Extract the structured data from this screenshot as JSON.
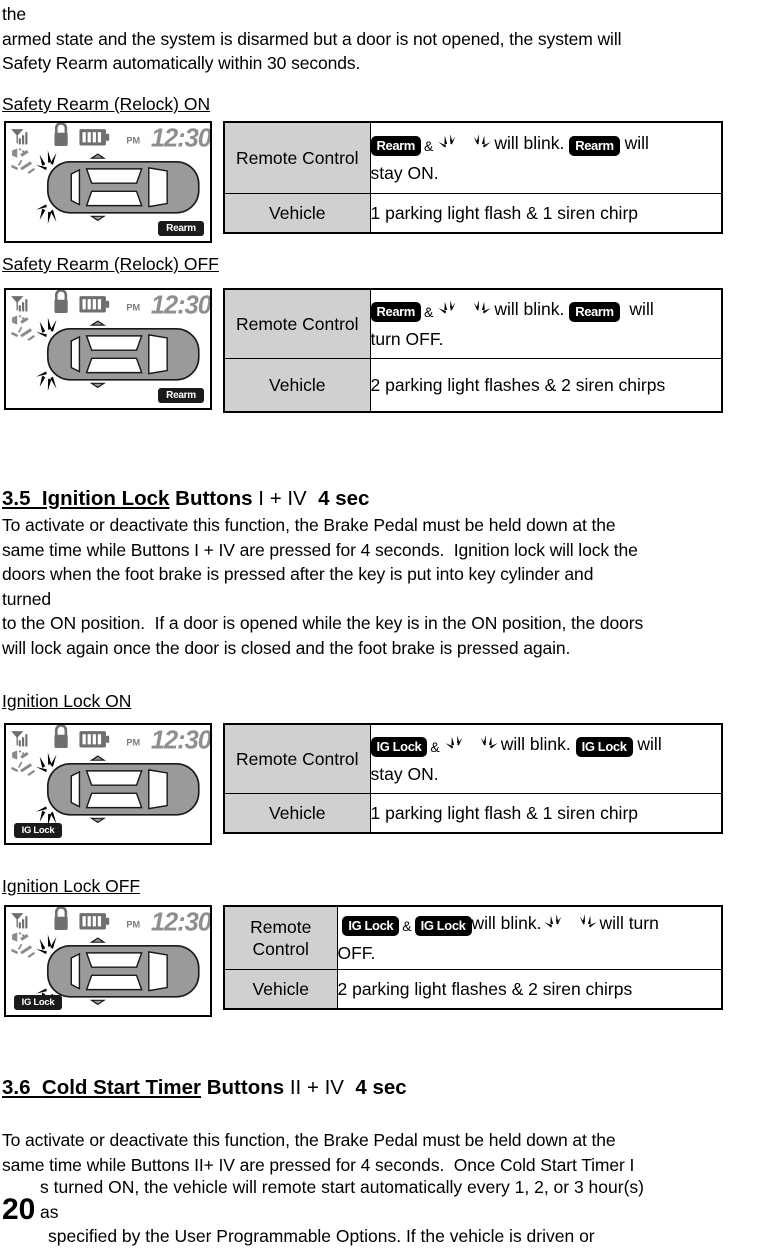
{
  "document": {
    "page_number": "20",
    "intro": {
      "line1": "the",
      "line2": "armed state and the system is disarmed but a door is not opened, the system will",
      "line3": "Safety Rearm automatically within 30 seconds."
    },
    "sections": [
      {
        "id": "safety-rearm-on",
        "heading": "Safety Rearm (Relock) ON",
        "lcd": {
          "time": "12:30",
          "meridiem": "PM",
          "badge": "Rearm",
          "icons": [
            "antenna-signal-icon",
            "lock-icon",
            "battery-icon",
            "siren-icon",
            "horn-icon",
            "car-top-view",
            "flash-burst-left-top",
            "flash-burst-left-bottom"
          ]
        },
        "rows": [
          {
            "label": "Remote Control",
            "value_parts": [
              {
                "type": "badge",
                "text": "Rearm"
              },
              {
                "type": "text",
                "text": "&"
              },
              {
                "type": "blink-icon"
              },
              {
                "type": "text",
                "text": "will blink."
              },
              {
                "type": "badge",
                "text": "Rearm"
              },
              {
                "type": "text",
                "text": "will stay ON."
              }
            ],
            "value_plain": "Rearm & (blink icons) will blink. Rearm will stay ON."
          },
          {
            "label": "Vehicle",
            "value_plain": "1 parking light flash & 1 siren chirp"
          }
        ]
      },
      {
        "id": "safety-rearm-off",
        "heading": "Safety Rearm (Relock) OFF",
        "lcd": {
          "time": "12:30",
          "meridiem": "PM",
          "badge": "Rearm",
          "icons": [
            "antenna-signal-icon",
            "lock-icon",
            "battery-icon",
            "siren-icon",
            "horn-icon",
            "car-top-view",
            "flash-burst-left-top",
            "flash-burst-left-bottom"
          ]
        },
        "rows": [
          {
            "label": "Remote Control",
            "value_plain": "Rearm & (blink icons) will blink. Rearm will turn OFF."
          },
          {
            "label": "Vehicle",
            "value_plain": "2 parking light flashes & 2 siren chirps"
          }
        ]
      }
    ],
    "section35": {
      "number": "3.5",
      "title": "Ignition Lock",
      "buttons_label": "Buttons",
      "buttons_combo": "I + IV",
      "duration": "4 sec",
      "body": "To activate or deactivate this function, the Brake Pedal must be held down at the\nsame time while Buttons I + IV are pressed for 4 seconds.  Ignition lock will lock the\ndoors when the foot brake is pressed after the key is put into key cylinder and\nturned\nto the ON position.  If a door is opened while the key is in the ON position, the doors\nwill lock again once the door is closed and the foot brake is pressed again.",
      "sub_sections": [
        {
          "id": "ignition-lock-on",
          "heading": "Ignition Lock ON",
          "lcd": {
            "time": "12:30",
            "meridiem": "PM",
            "badge": "IG Lock"
          },
          "rows": [
            {
              "label": "Remote Control",
              "value_plain": "IG Lock & (blink icons) will blink. IG Lock will stay ON."
            },
            {
              "label": "Vehicle",
              "value_plain": "1 parking light flash & 1 siren chirp"
            }
          ]
        },
        {
          "id": "ignition-lock-off",
          "heading": "Ignition Lock OFF",
          "lcd": {
            "time": "12:30",
            "meridiem": "PM",
            "badge": "IG Lock"
          },
          "rows": [
            {
              "label": "Remote\nControl",
              "value_plain": "IG Lock & IG Lock will blink. (blink icons) will turn OFF."
            },
            {
              "label": "Vehicle",
              "value_plain": "2 parking light flashes & 2 siren chirps"
            }
          ]
        }
      ]
    },
    "section36": {
      "number": "3.6",
      "title": "Cold Start Timer",
      "buttons_label": "Buttons",
      "buttons_combo": "II + IV",
      "duration": "4 sec",
      "body_line1": "To activate or deactivate this function, the Brake Pedal must be held down at the",
      "body_line2": "same time while Buttons II+ IV are pressed for 4 seconds.  Once Cold Start Timer I",
      "body_line3": "s turned ON, the vehicle will remote start automatically every 1, 2, or 3 hour(s)",
      "body_line4": "as",
      "body_line5": "specified by the User Programmable Options.  If the vehicle is driven or"
    },
    "labels": {
      "amp": "&",
      "will_blink": "will blink.",
      "will": "will",
      "stay_on": "stay ON.",
      "turn_off": "turn OFF.",
      "off_only": "OFF.",
      "will_turn": "will turn",
      "badge_rearm": "Rearm",
      "badge_iglock": "IG Lock"
    },
    "colors": {
      "header_cell_bg": "#d0d0d0",
      "badge_bg": "#000000",
      "badge_fg": "#ffffff",
      "border": "#000000",
      "car_body": "#8c8c8c",
      "lcd_gray": "#9a9a9a"
    }
  }
}
